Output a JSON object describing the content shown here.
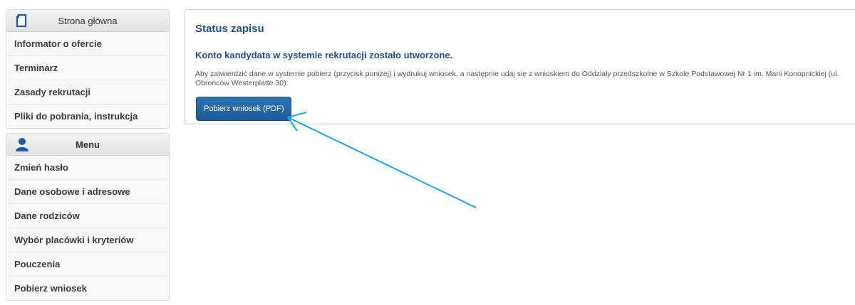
{
  "sidebar": {
    "home_panel": {
      "header": "Strona główna",
      "icon": "document-icon",
      "items": [
        {
          "label": "Informator o ofercie"
        },
        {
          "label": "Terminarz"
        },
        {
          "label": "Zasady rekrutacji"
        },
        {
          "label": "Pliki do pobrania, instrukcja"
        }
      ]
    },
    "menu_panel": {
      "header": "Menu",
      "icon": "user-icon",
      "items": [
        {
          "label": "Zmień hasło"
        },
        {
          "label": "Dane osobowe i adresowe"
        },
        {
          "label": "Dane rodziców"
        },
        {
          "label": "Wybór placówki i kryteriów"
        },
        {
          "label": "Pouczenia"
        },
        {
          "label": "Pobierz wniosek"
        }
      ]
    }
  },
  "main": {
    "title": "Status zapisu",
    "subtitle": "Konto kandydata w systemie rekrutacji zostało utworzone.",
    "message": "Aby zatwierdzić dane w systemie pobierz (przycisk poniżej) i wydrukuj wniosek, a następnie udaj się z wnioskiem do Oddziały przedszkolne w Szkole Podstawowej Nr 1 im. Marii Konopnickiej (ul. Obrońców Westerplatte 30).",
    "download_button": "Pobierz wniosek (PDF)"
  },
  "colors": {
    "heading_blue": "#1f4e8c",
    "button_blue": "#2a6bab",
    "annotation_arrow": "#1aa6e6"
  }
}
